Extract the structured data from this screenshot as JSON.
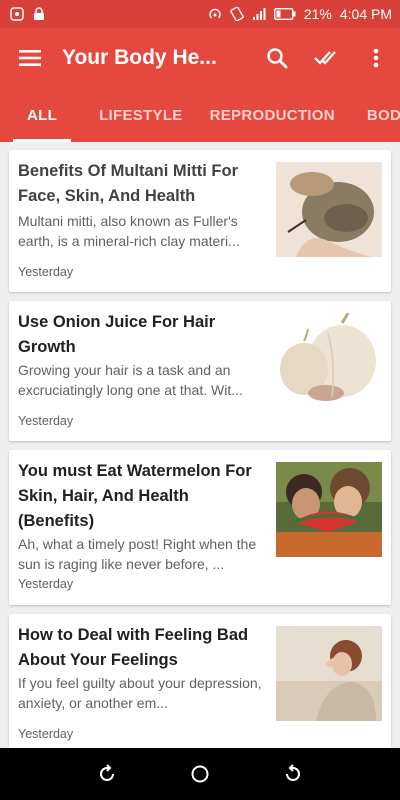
{
  "status": {
    "battery": "21%",
    "time": "4:04 PM"
  },
  "appbar": {
    "title": "Your Body He...",
    "icons": [
      "menu-icon",
      "search-icon",
      "double-check-icon",
      "more-vert-icon"
    ]
  },
  "tabs": [
    {
      "label": "ALL",
      "active": true
    },
    {
      "label": "LIFESTYLE",
      "active": false
    },
    {
      "label": "REPRODUCTION",
      "active": false
    },
    {
      "label": "BODY",
      "active": false
    }
  ],
  "articles": [
    {
      "title": "Benefits Of Multani Mitti For Face, Skin, And Health",
      "excerpt": "Multani mitti, also known as Fuller's earth, is a mineral-rich clay materi...",
      "time": "Yesterday"
    },
    {
      "title": "Use Onion Juice For Hair Growth",
      "excerpt": "Growing your hair is a task and an excruciatingly long one at that. Wit...",
      "time": "Yesterday"
    },
    {
      "title": "You must Eat Watermelon For Skin, Hair, And Health (Benefits)",
      "excerpt": "Ah, what a timely post! Right when the sun is raging like never before, ...",
      "time": "Yesterday"
    },
    {
      "title": "How to Deal with Feeling Bad About Your Feelings",
      "excerpt": "If you feel guilty about your depression, anxiety, or another em...",
      "time": "Yesterday"
    }
  ],
  "colors": {
    "primary": "#e5483f",
    "statusbar": "#d9403a",
    "background": "#eeeeee"
  }
}
